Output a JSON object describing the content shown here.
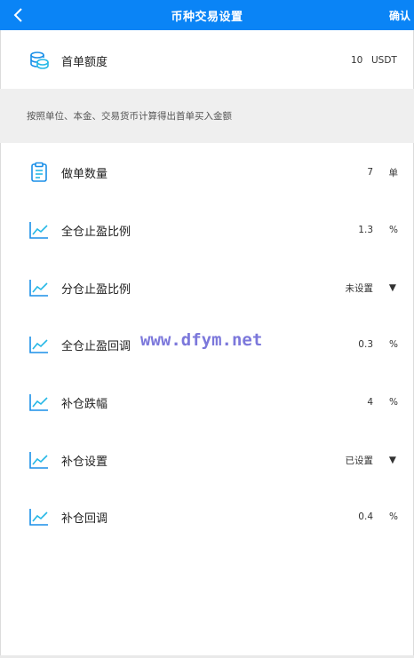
{
  "header": {
    "title": "币种交易设置",
    "confirm_label": "确认"
  },
  "first_order": {
    "label": "首单额度",
    "value": "10",
    "unit": "USDT"
  },
  "hint": "按照单位、本金、交易货币计算得出首单买入金额",
  "settings": [
    {
      "label": "做单数量",
      "value": "7",
      "unit": "单",
      "icon": "clipboard-icon"
    },
    {
      "label": "全仓止盈比例",
      "value": "1.3",
      "unit": "%",
      "icon": "line-chart-icon"
    },
    {
      "label": "分仓止盈比例",
      "value": "未设置",
      "unit": "▼",
      "icon": "line-chart-icon"
    },
    {
      "label": "全仓止盈回调",
      "value": "0.3",
      "unit": "%",
      "icon": "line-chart-icon"
    },
    {
      "label": "补仓跌幅",
      "value": "4",
      "unit": "%",
      "icon": "line-chart-icon"
    },
    {
      "label": "补仓设置",
      "value": "已设置",
      "unit": "▼",
      "icon": "line-chart-icon"
    },
    {
      "label": "补仓回调",
      "value": "0.4",
      "unit": "%",
      "icon": "line-chart-icon"
    }
  ],
  "watermark": "www.dfym.net",
  "colors": {
    "header_bg": "#0a84f6",
    "icon_blue": "#1a8fe8",
    "hint_bg": "#efefef"
  }
}
